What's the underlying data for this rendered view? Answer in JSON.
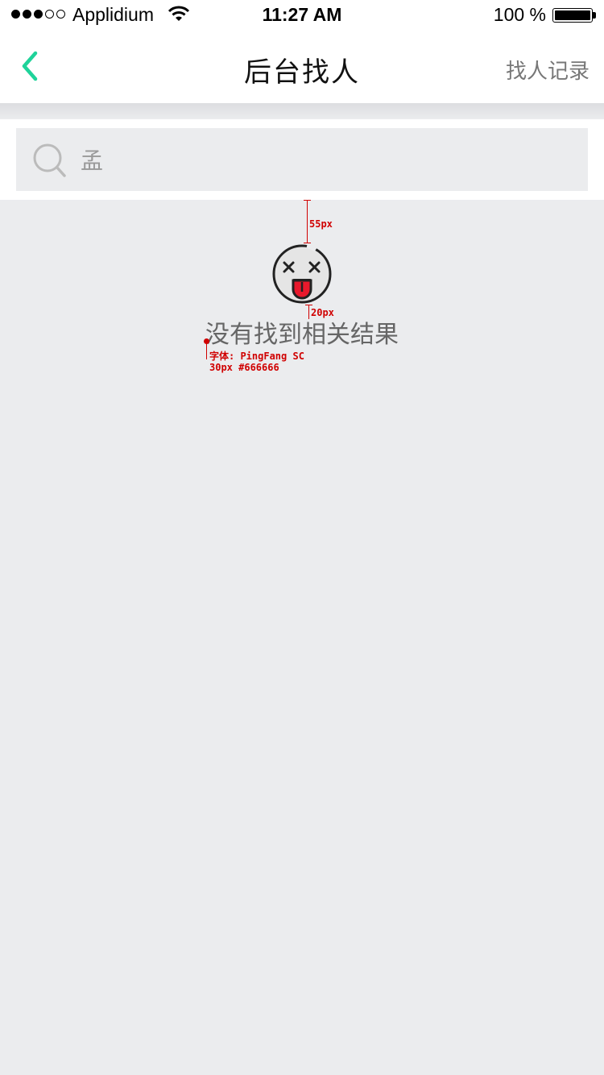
{
  "status_bar": {
    "carrier": "Applidium",
    "time": "11:27 AM",
    "battery": "100 %"
  },
  "nav": {
    "back_icon": "chevron-left-icon",
    "title": "后台找人",
    "right_action": "找人记录",
    "accent_color": "#1fd39a"
  },
  "search": {
    "icon": "search-icon",
    "value": "孟"
  },
  "empty_state": {
    "icon": "dizzy-face-tongue-icon",
    "message": "没有找到相关结果",
    "text_color": "#666666"
  },
  "annotations": {
    "top_spacing": "55px",
    "bottom_spacing": "20px",
    "font_label": "字体: PingFang SC",
    "font_spec": "30px #666666"
  }
}
